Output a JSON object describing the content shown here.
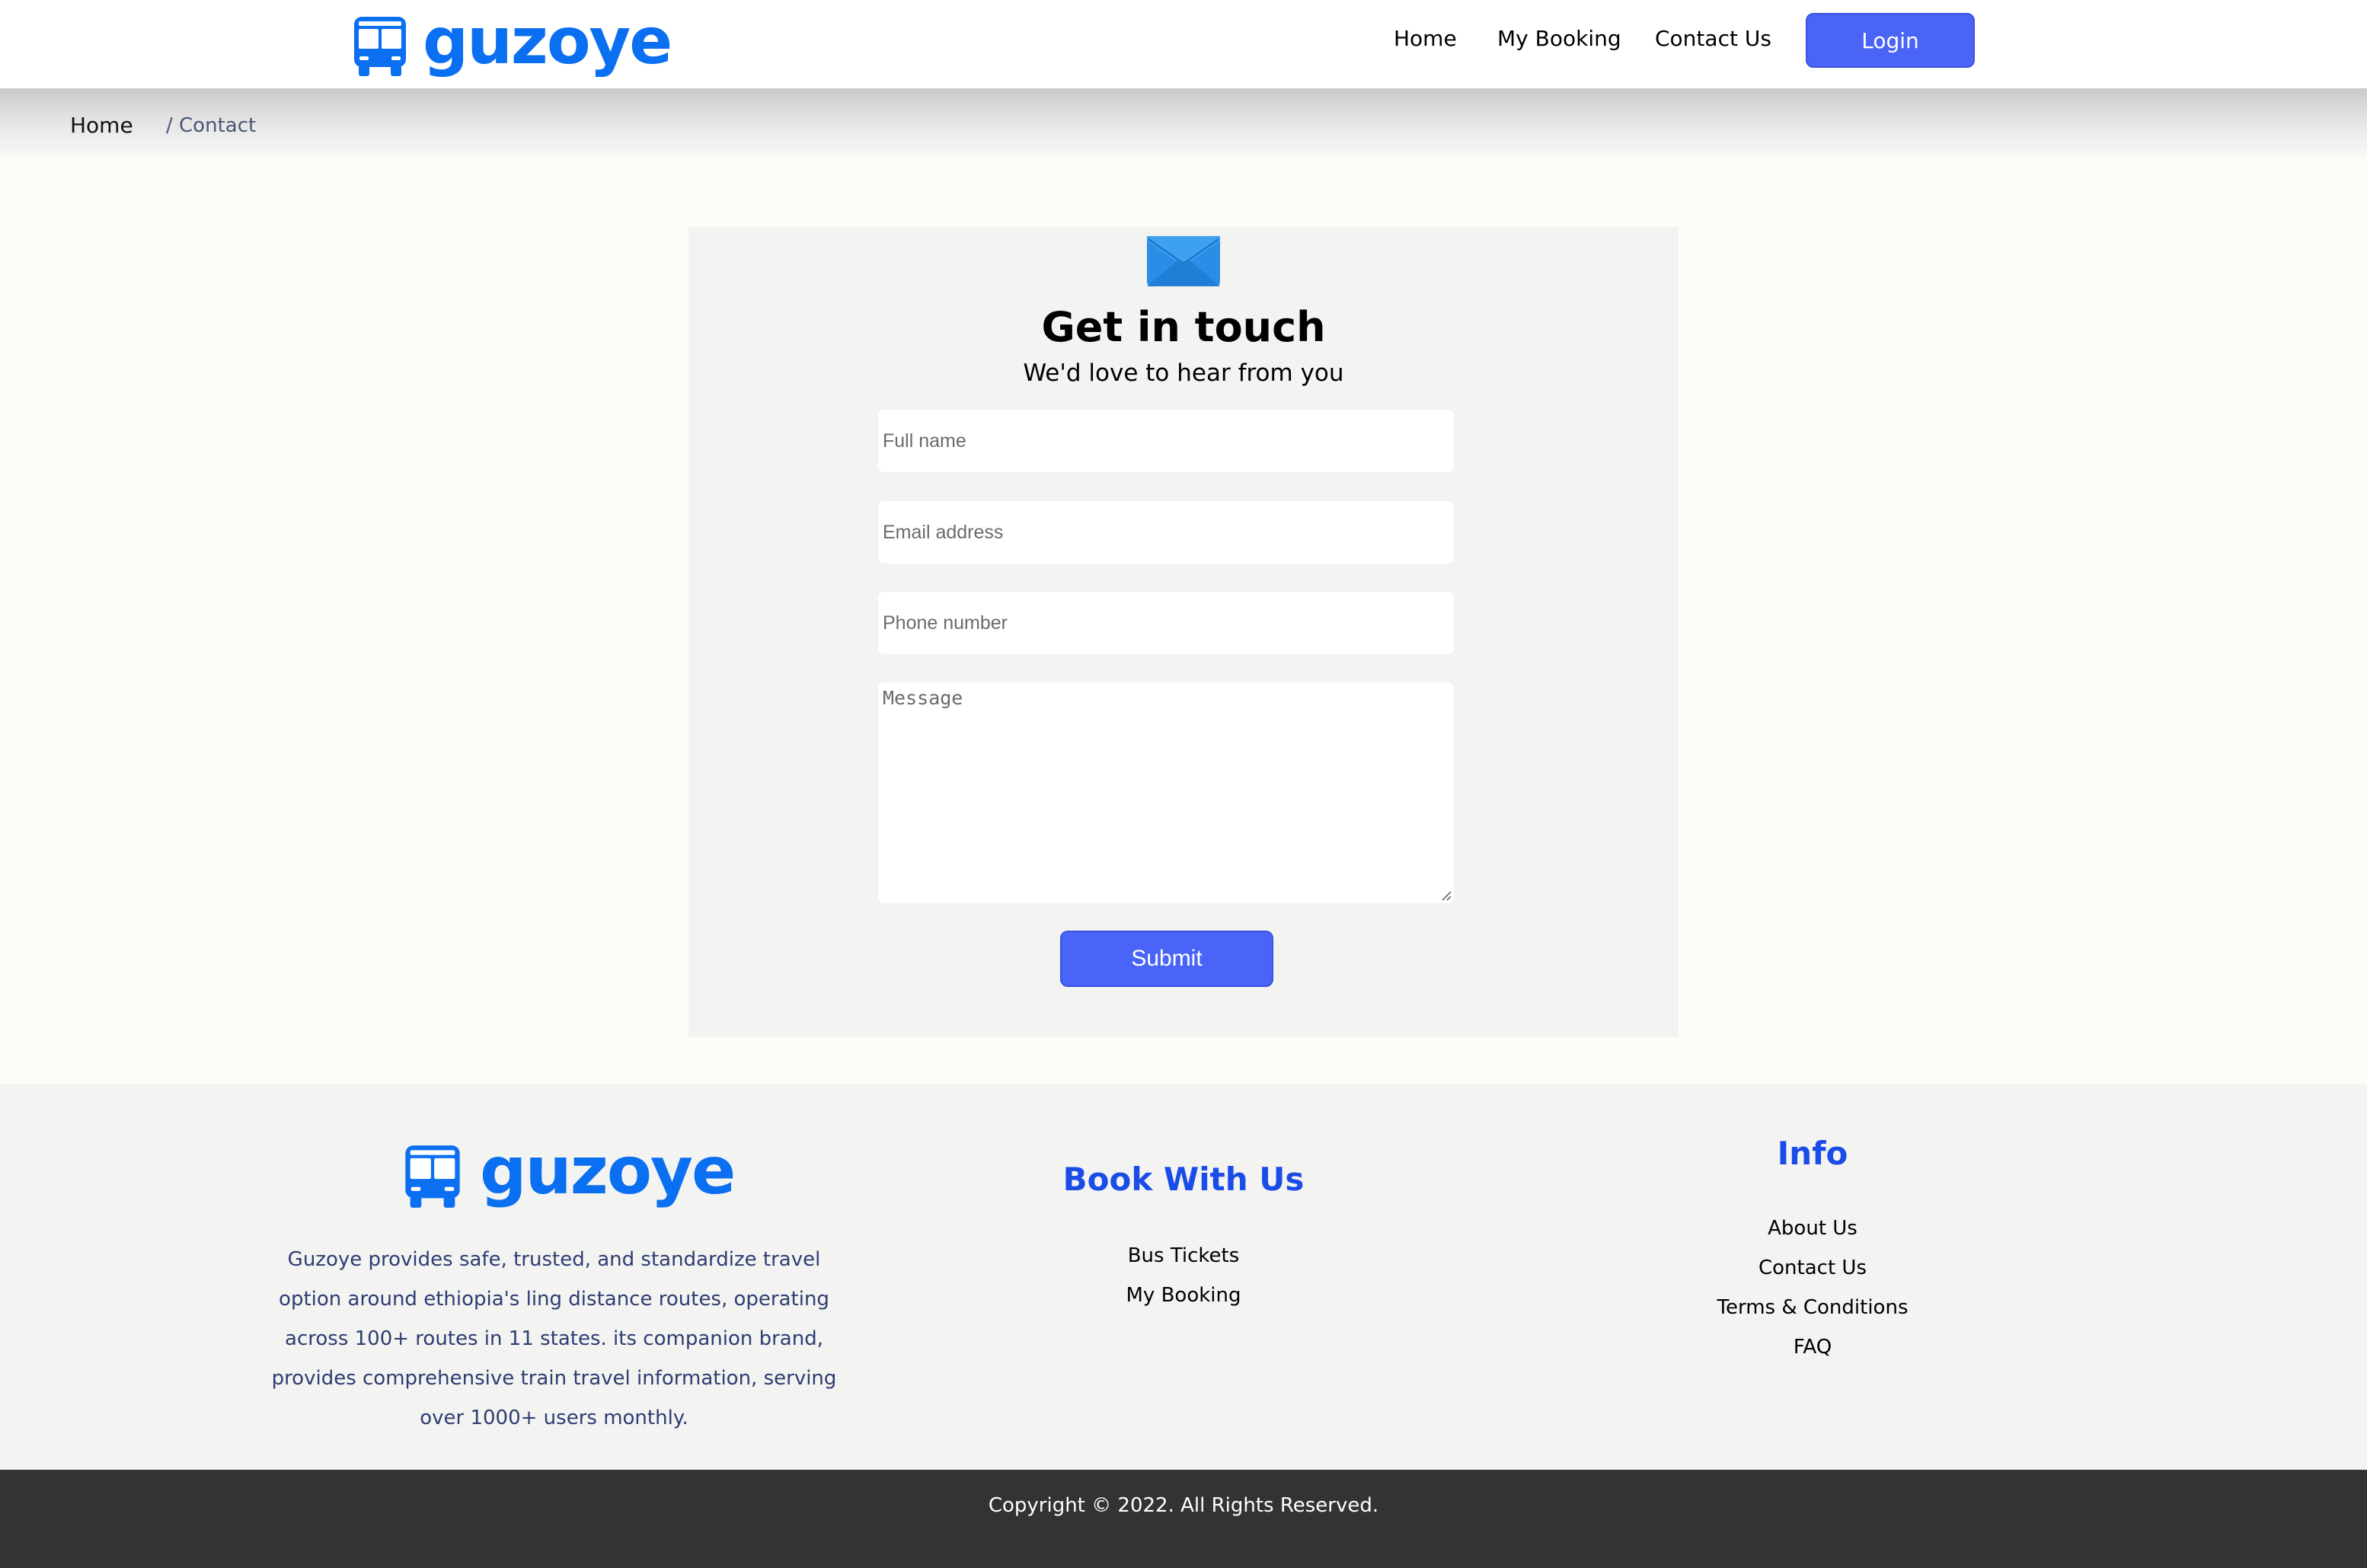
{
  "brand": {
    "name": "guzoye",
    "logo_icon": "bus-icon",
    "color": "#0a6ff0"
  },
  "nav": {
    "home": "Home",
    "my_booking": "My Booking",
    "contact_us": "Contact Us",
    "login": "Login"
  },
  "breadcrumb": {
    "home": "Home",
    "current": "/ Contact"
  },
  "contact_form": {
    "icon": "mail-icon",
    "title": "Get in touch",
    "subtitle": "We'd love to hear from you",
    "full_name_placeholder": "Full name",
    "email_placeholder": "Email address",
    "phone_placeholder": "Phone number",
    "message_placeholder": "Message",
    "full_name_value": "",
    "email_value": "",
    "phone_value": "",
    "message_value": "",
    "submit": "Submit"
  },
  "footer": {
    "description": "Guzoye provides safe, trusted, and standardize travel option around ethiopia's ling distance routes, operating across 100+ routes in 11 states. its companion brand, provides comprehensive train travel information, serving over 1000+ users monthly.",
    "book_with_us": {
      "title": "Book With Us",
      "links": [
        "Bus Tickets",
        "My Booking"
      ]
    },
    "info": {
      "title": "Info",
      "links": [
        "About Us",
        "Contact Us",
        "Terms & Conditions",
        "FAQ"
      ]
    }
  },
  "copyright": "Copyright © 2022. All Rights Reserved.",
  "colors": {
    "accent": "#4a64f8",
    "heading_blue": "#1a4de8",
    "footer_dark": "#333333"
  }
}
